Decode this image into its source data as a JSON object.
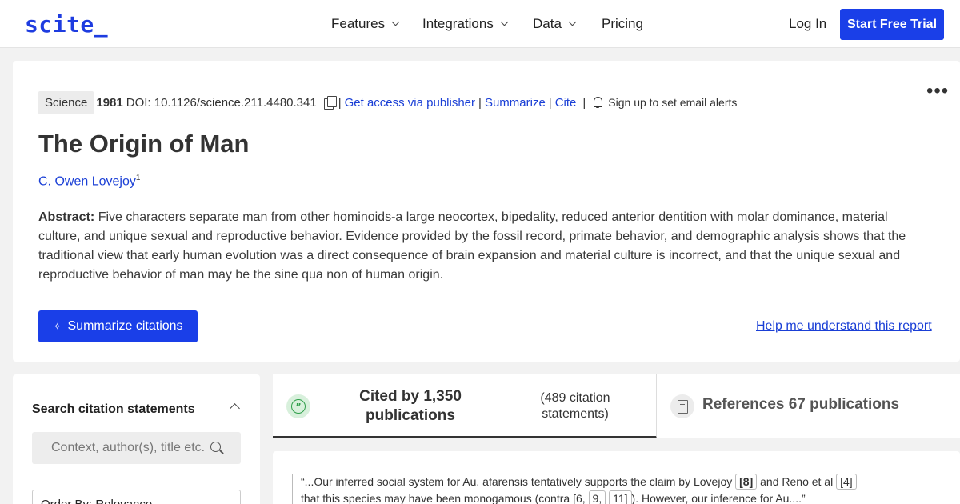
{
  "header": {
    "logo": "scite_",
    "nav": [
      "Features",
      "Integrations",
      "Data",
      "Pricing"
    ],
    "login": "Log In",
    "cta": "Start Free Trial"
  },
  "paper": {
    "journal": "Science",
    "year": "1981",
    "doi": "DOI: 10.1126/science.211.4480.341",
    "access_link": "Get access via publisher",
    "summarize_link": "Summarize",
    "cite_link": "Cite",
    "alerts": "Sign up to set email alerts",
    "title": "The Origin of Man",
    "author": "C. Owen Lovejoy",
    "author_sup": "1",
    "abstract_label": "Abstract:",
    "abstract": "Five characters separate man from other hominoids-a large neocortex, bipedality, reduced anterior dentition with molar dominance, material culture, and unique sexual and reproductive behavior. Evidence provided by the fossil record, primate behavior, and demographic analysis shows that the traditional view that early human evolution was a direct consequence of brain expansion and material culture is incorrect, and that the unique sexual and reproductive behavior of man may be the sine qua non of human origin.",
    "summarize_button": "Summarize citations",
    "help_link": "Help me understand this report"
  },
  "sidebar": {
    "title": "Search citation statements",
    "search_placeholder": "Context, author(s), title etc.",
    "order": "Order By: Relevance"
  },
  "tabs": {
    "cited_by": "Cited by 1,350 publications",
    "statements": "(489 citation statements)",
    "references": "References 67 publications"
  },
  "statement": {
    "part1": "“...Our inferred social system for Au. afarensis tentatively supports the claim by Lovejoy ",
    "ref1": "[8]",
    "part2": " and Reno et al ",
    "ref2": "[4]",
    "part3": " that this species may have been monogamous (contra [6, ",
    "ref3": "9,",
    "part4": " ",
    "ref4": "11]",
    "part5": "). However, our inference for Au....”"
  }
}
